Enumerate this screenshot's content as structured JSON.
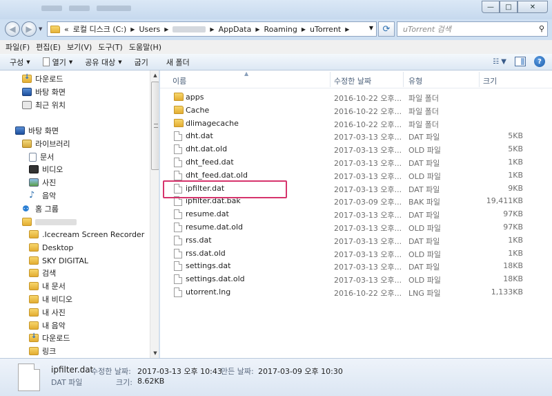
{
  "window": {
    "min_label": "—",
    "max_label": "□",
    "close_label": "✕"
  },
  "address": {
    "prefix": "«",
    "segments": [
      "로컬 디스크 (C:)",
      "Users",
      "AppData",
      "Roaming",
      "uTorrent"
    ]
  },
  "search": {
    "placeholder": "uTorrent 검색"
  },
  "menu": [
    "파일(F)",
    "편집(E)",
    "보기(V)",
    "도구(T)",
    "도움말(H)"
  ],
  "toolbar": {
    "organize": "구성",
    "open": "열기",
    "share": "공유 대상",
    "burn": "굽기",
    "new_folder": "새 폴더"
  },
  "nav_tree": {
    "items": [
      {
        "label": "다운로드",
        "icon": "downloads-icon"
      },
      {
        "label": "바탕 화면",
        "icon": "desktop-icon"
      },
      {
        "label": "최근 위치",
        "icon": "recent-places-icon"
      },
      {
        "label": "바탕 화면",
        "icon": "desktop-icon"
      },
      {
        "label": "라이브러리",
        "icon": "libraries-icon"
      },
      {
        "label": "문서",
        "icon": "documents-icon"
      },
      {
        "label": "비디오",
        "icon": "videos-icon"
      },
      {
        "label": "사진",
        "icon": "pictures-icon"
      },
      {
        "label": "음악",
        "icon": "music-icon"
      },
      {
        "label": "홈 그룹",
        "icon": "homegroup-icon"
      },
      {
        "label": ".Icecream Screen Recorder",
        "icon": "folder-icon"
      },
      {
        "label": "Desktop",
        "icon": "folder-icon"
      },
      {
        "label": "SKY DIGITAL",
        "icon": "folder-icon"
      },
      {
        "label": "검색",
        "icon": "search-folder-icon"
      },
      {
        "label": "내 문서",
        "icon": "folder-icon"
      },
      {
        "label": "내 비디오",
        "icon": "folder-icon"
      },
      {
        "label": "내 사진",
        "icon": "folder-icon"
      },
      {
        "label": "내 음악",
        "icon": "folder-icon"
      },
      {
        "label": "다운로드",
        "icon": "downloads-icon"
      },
      {
        "label": "링크",
        "icon": "folder-icon"
      }
    ]
  },
  "columns": {
    "name": "이름",
    "date": "수정한 날짜",
    "type": "유형",
    "size": "크기"
  },
  "files": [
    {
      "name": "apps",
      "date": "2016-10-22 오후...",
      "type": "파일 폴더",
      "size": "",
      "kind": "folder"
    },
    {
      "name": "Cache",
      "date": "2016-10-22 오후...",
      "type": "파일 폴더",
      "size": "",
      "kind": "folder"
    },
    {
      "name": "dlimagecache",
      "date": "2016-10-22 오후...",
      "type": "파일 폴더",
      "size": "",
      "kind": "folder"
    },
    {
      "name": "dht.dat",
      "date": "2017-03-13 오후...",
      "type": "DAT 파일",
      "size": "5KB",
      "kind": "file"
    },
    {
      "name": "dht.dat.old",
      "date": "2017-03-13 오후...",
      "type": "OLD 파일",
      "size": "5KB",
      "kind": "file"
    },
    {
      "name": "dht_feed.dat",
      "date": "2017-03-13 오후...",
      "type": "DAT 파일",
      "size": "1KB",
      "kind": "file"
    },
    {
      "name": "dht_feed.dat.old",
      "date": "2017-03-13 오후...",
      "type": "OLD 파일",
      "size": "1KB",
      "kind": "file"
    },
    {
      "name": "ipfilter.dat",
      "date": "2017-03-13 오후...",
      "type": "DAT 파일",
      "size": "9KB",
      "kind": "file"
    },
    {
      "name": "ipfilter.dat.bak",
      "date": "2017-03-09 오후...",
      "type": "BAK 파일",
      "size": "19,411KB",
      "kind": "file"
    },
    {
      "name": "resume.dat",
      "date": "2017-03-13 오후...",
      "type": "DAT 파일",
      "size": "97KB",
      "kind": "file"
    },
    {
      "name": "resume.dat.old",
      "date": "2017-03-13 오후...",
      "type": "OLD 파일",
      "size": "97KB",
      "kind": "file"
    },
    {
      "name": "rss.dat",
      "date": "2017-03-13 오후...",
      "type": "DAT 파일",
      "size": "1KB",
      "kind": "file"
    },
    {
      "name": "rss.dat.old",
      "date": "2017-03-13 오후...",
      "type": "OLD 파일",
      "size": "1KB",
      "kind": "file"
    },
    {
      "name": "settings.dat",
      "date": "2017-03-13 오후...",
      "type": "DAT 파일",
      "size": "18KB",
      "kind": "file"
    },
    {
      "name": "settings.dat.old",
      "date": "2017-03-13 오후...",
      "type": "OLD 파일",
      "size": "18KB",
      "kind": "file"
    },
    {
      "name": "utorrent.lng",
      "date": "2016-10-22 오후...",
      "type": "LNG 파일",
      "size": "1,133KB",
      "kind": "file"
    }
  ],
  "details": {
    "name": "ipfilter.dat",
    "modified_label": "수정한 날짜:",
    "modified": "2017-03-13 오후 10:43",
    "created_label": "만든 날짜:",
    "created": "2017-03-09 오후 10:30",
    "type": "DAT 파일",
    "size_label": "크기:",
    "size": "8.62KB"
  },
  "colors": {
    "highlight": "#d6336c",
    "accent": "#2c6fb0"
  }
}
